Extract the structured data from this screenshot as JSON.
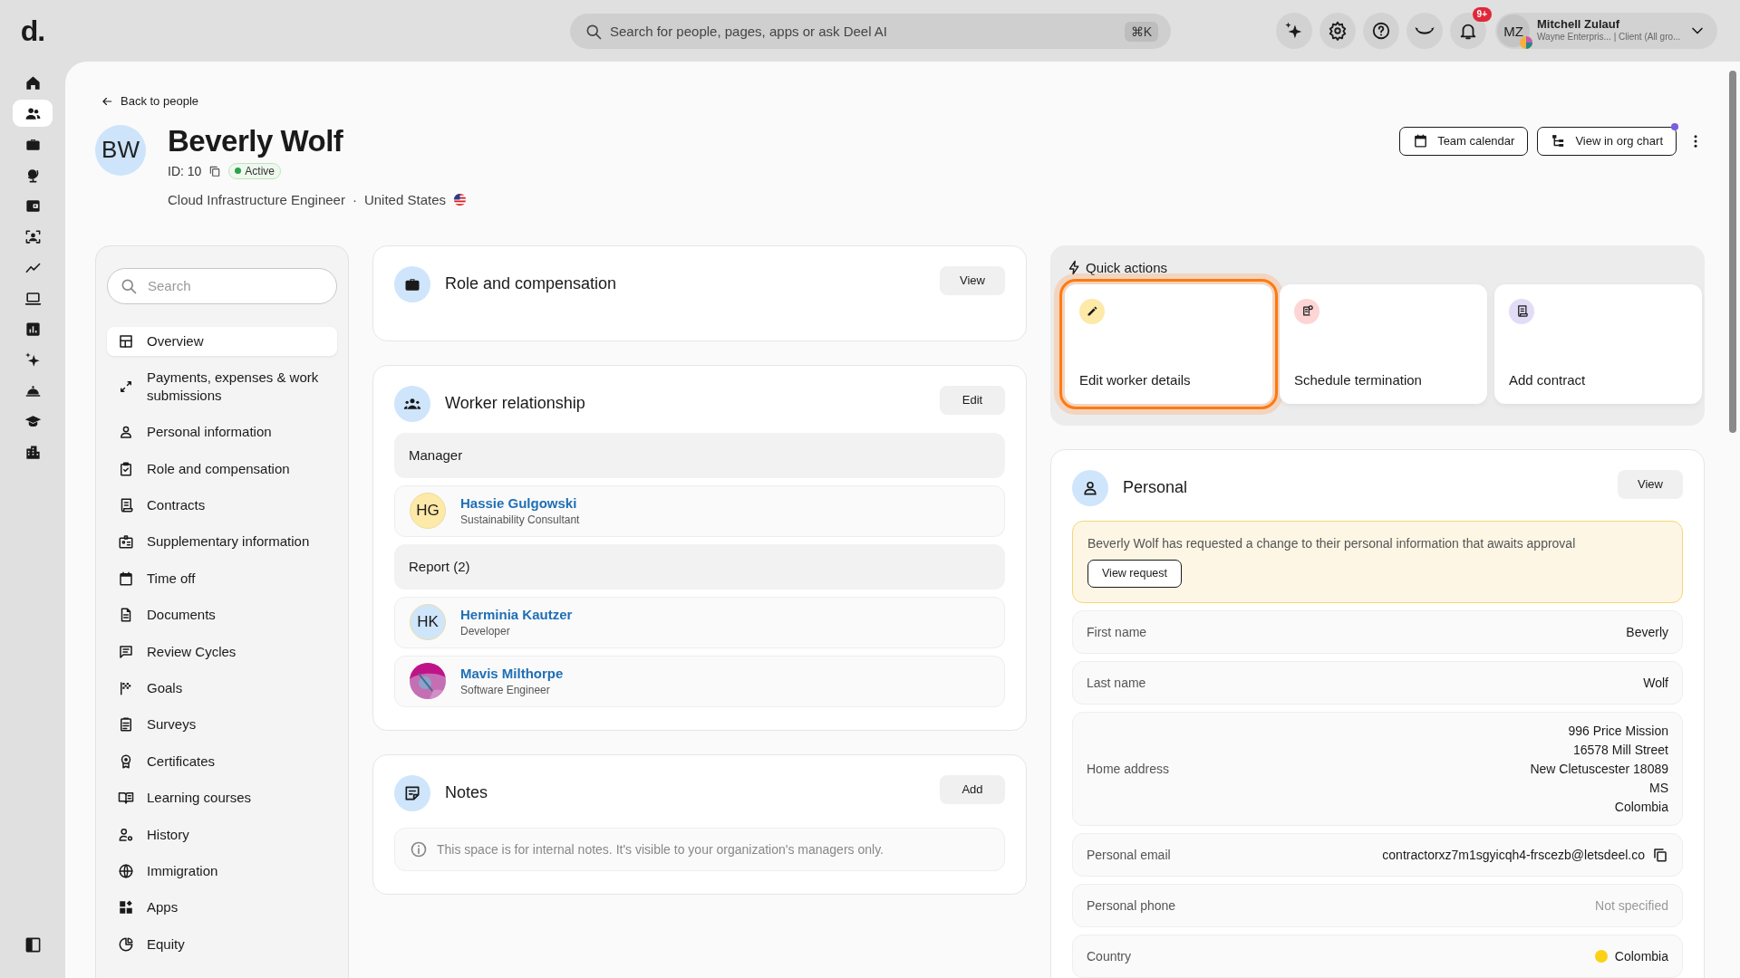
{
  "topbar": {
    "logo": "d.",
    "search": {
      "placeholder": "Search for people, pages, apps or ask Deel AI",
      "shortcut": "⌘K"
    },
    "icon_buttons": [
      {
        "kind": "sparkle"
      },
      {
        "kind": "gear"
      },
      {
        "kind": "help"
      },
      {
        "kind": "eye-closed"
      },
      {
        "kind": "bell",
        "badge": "9+"
      }
    ],
    "user": {
      "initials": "MZ",
      "name": "Mitchell Zulauf",
      "subtitle": "Wayne Enterpris... | Client (All gro..."
    }
  },
  "nav_rail": {
    "items": [
      {
        "kind": "home",
        "selected": false
      },
      {
        "kind": "people",
        "selected": true
      },
      {
        "kind": "briefcase",
        "selected": false
      },
      {
        "kind": "globe-stand",
        "selected": false
      },
      {
        "kind": "wallet",
        "selected": false
      },
      {
        "kind": "person-scan",
        "selected": false
      },
      {
        "kind": "trend",
        "selected": false
      },
      {
        "kind": "laptop",
        "selected": false
      },
      {
        "kind": "bar-chart",
        "selected": false
      },
      {
        "kind": "sparkle",
        "selected": false
      },
      {
        "kind": "cloche",
        "selected": false
      },
      {
        "kind": "graduation",
        "selected": false
      },
      {
        "kind": "buildings",
        "selected": false
      }
    ]
  },
  "back_link": "Back to people",
  "profile": {
    "initials": "BW",
    "name": "Beverly Wolf",
    "id": "ID: 10",
    "status": "Active",
    "job_title": "Cloud Infrastructure Engineer",
    "separator": "·",
    "country": "United States"
  },
  "header_actions": [
    {
      "label": "Team calendar",
      "kind": "calendar",
      "dot": false
    },
    {
      "label": "View in org chart",
      "kind": "org",
      "dot": true
    }
  ],
  "sidebar": {
    "search": {
      "placeholder": "Search"
    },
    "items": [
      {
        "label": "Overview",
        "kind": "layout",
        "selected": true
      },
      {
        "label": "Payments, expenses & work submissions",
        "kind": "arrows",
        "selected": false
      },
      {
        "label": "Personal information",
        "kind": "person",
        "selected": false
      },
      {
        "label": "Role and compensation",
        "kind": "clipboard-check",
        "selected": false
      },
      {
        "label": "Contracts",
        "kind": "receipt",
        "selected": false
      },
      {
        "label": "Supplementary information",
        "kind": "id-badge",
        "selected": false
      },
      {
        "label": "Time off",
        "kind": "calendar",
        "selected": false
      },
      {
        "label": "Documents",
        "kind": "document",
        "selected": false
      },
      {
        "label": "Review Cycles",
        "kind": "chat",
        "selected": false
      },
      {
        "label": "Goals",
        "kind": "flag",
        "selected": false
      },
      {
        "label": "Surveys",
        "kind": "list",
        "selected": false
      },
      {
        "label": "Certificates",
        "kind": "award",
        "selected": false
      },
      {
        "label": "Learning courses",
        "kind": "book",
        "selected": false
      },
      {
        "label": "History",
        "kind": "person-gear",
        "selected": false
      },
      {
        "label": "Immigration",
        "kind": "globe",
        "selected": false
      },
      {
        "label": "Apps",
        "kind": "apps",
        "selected": false
      },
      {
        "label": "Equity",
        "kind": "pie",
        "selected": false
      }
    ]
  },
  "role_card": {
    "title": "Role and compensation",
    "kind": "briefcase",
    "button": "View"
  },
  "worker_relationship": {
    "title": "Worker relationship",
    "kind": "team",
    "button": "Edit",
    "groups": [
      {
        "label": "Manager",
        "people": [
          {
            "name": "Hassie Gulgowski",
            "role": "Sustainability Consultant",
            "avatar": {
              "kind": "initials",
              "initials": "HG",
              "color": "#fde9a8"
            }
          }
        ]
      },
      {
        "label": "Report (2)",
        "people": [
          {
            "name": "Herminia Kautzer",
            "role": "Developer",
            "avatar": {
              "kind": "initials",
              "initials": "HK",
              "color": "#cfe5fb"
            }
          },
          {
            "name": "Mavis Milthorpe",
            "role": "Software Engineer"
          }
        ]
      }
    ]
  },
  "notes": {
    "title": "Notes",
    "kind": "note",
    "button": "Add",
    "info": "This space is for internal notes. It's visible to your organization's managers only."
  },
  "quick_actions": {
    "title": "Quick actions",
    "items": [
      {
        "label": "Edit worker details",
        "kind": "pencil",
        "color": "#fde9a8",
        "highlighted": true
      },
      {
        "label": "Schedule termination",
        "kind": "receipt-clock",
        "color": "#fdd5d5",
        "highlighted": false
      },
      {
        "label": "Add contract",
        "kind": "receipt",
        "color": "#e3dcf7",
        "highlighted": false
      }
    ]
  },
  "personal": {
    "title": "Personal",
    "button": "View",
    "alert": {
      "text": "Beverly Wolf has requested a change to their personal information that awaits approval",
      "button": "View request"
    },
    "fields": [
      {
        "label": "First name",
        "lines": [
          "Beverly"
        ],
        "kind": "text"
      },
      {
        "label": "Last name",
        "lines": [
          "Wolf"
        ],
        "kind": "text"
      },
      {
        "label": "Home address",
        "lines": [
          "996 Price Mission",
          "16578 Mill Street",
          "New Cletuscester 18089",
          "MS",
          "Colombia"
        ],
        "kind": "text"
      },
      {
        "label": "Personal email",
        "lines": [
          "contractorxz7m1sgyicqh4-frscezb@letsdeel.co"
        ],
        "kind": "copy"
      },
      {
        "label": "Personal phone",
        "lines": [
          "Not specified"
        ],
        "kind": "empty"
      },
      {
        "label": "Country",
        "lines": [
          "Colombia"
        ],
        "kind": "flag"
      }
    ]
  }
}
